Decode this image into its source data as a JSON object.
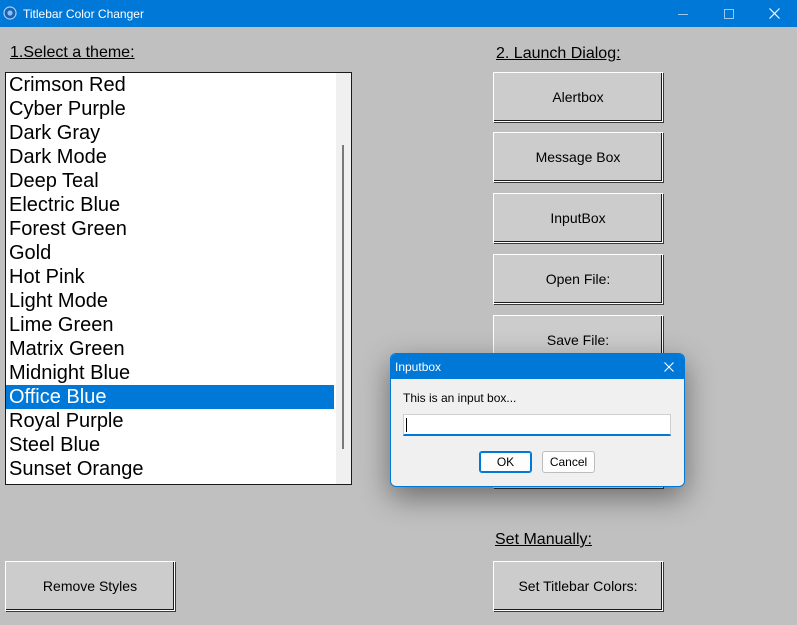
{
  "window": {
    "title": "Titlebar Color Changer",
    "accent_color": "#0078d7",
    "background_color": "#c0c0c0",
    "icons": {
      "app": "app-icon",
      "minimize": "minimize-icon",
      "maximize": "maximize-icon",
      "close": "close-icon"
    }
  },
  "theme_section": {
    "label": "1.Select a theme:",
    "items": [
      "Crimson Red",
      "Cyber Purple",
      "Dark Gray",
      "Dark Mode",
      "Deep Teal",
      "Electric Blue",
      "Forest Green",
      "Gold",
      "Hot Pink",
      "Light Mode",
      "Lime Green",
      "Matrix Green",
      "Midnight Blue",
      "Office Blue",
      "Royal Purple",
      "Steel Blue",
      "Sunset Orange"
    ],
    "selected": "Office Blue"
  },
  "dialog_section": {
    "label": "2. Launch Dialog:",
    "buttons": {
      "alertbox": "Alertbox",
      "message_box": "Message Box",
      "inputbox": "InputBox",
      "open_file": "Open File:",
      "save_file": "Save File:"
    }
  },
  "remove_styles_label": "Remove Styles",
  "manual_section": {
    "label": "Set Manually:",
    "button": "Set Titlebar Colors:"
  },
  "input_dialog": {
    "title": "Inputbox",
    "prompt": "This is an input box...",
    "input_value": "",
    "ok_label": "OK",
    "cancel_label": "Cancel",
    "close_icon": "close-icon"
  }
}
